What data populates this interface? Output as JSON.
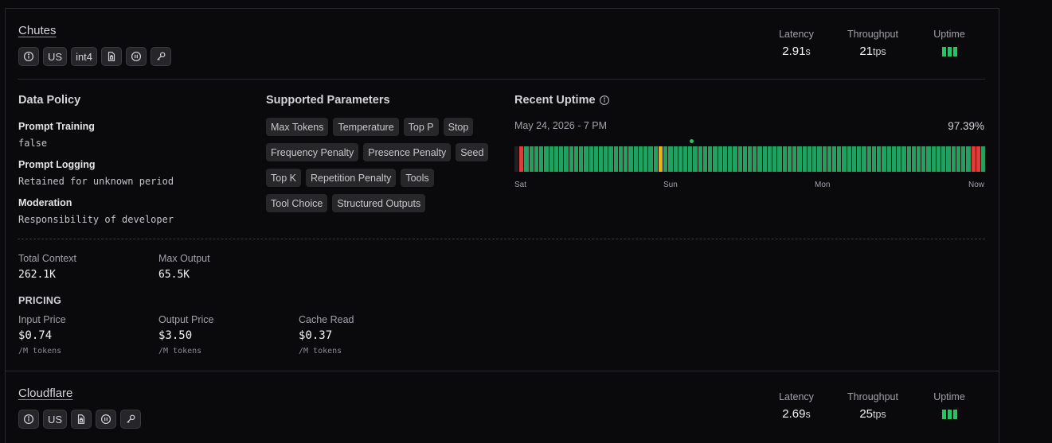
{
  "providers": [
    {
      "name": "Chutes",
      "tags": [
        {
          "icon": "info-icon"
        },
        {
          "label": "US"
        },
        {
          "label": "int4"
        },
        {
          "icon": "document-lock-icon"
        },
        {
          "icon": "pause-circle-icon"
        },
        {
          "icon": "key-icon"
        }
      ],
      "latency": {
        "label": "Latency",
        "value": "2.91",
        "unit": "s"
      },
      "throughput": {
        "label": "Throughput",
        "value": "21",
        "unit": "tps"
      },
      "uptime_label": "Uptime",
      "data_policy": {
        "title": "Data Policy",
        "items": [
          {
            "label": "Prompt Training",
            "value": "false"
          },
          {
            "label": "Prompt Logging",
            "value": "Retained for unknown period"
          },
          {
            "label": "Moderation",
            "value": "Responsibility of developer"
          }
        ]
      },
      "supported_parameters": {
        "title": "Supported Parameters",
        "items": [
          "Max Tokens",
          "Temperature",
          "Top P",
          "Stop",
          "Frequency Penalty",
          "Presence Penalty",
          "Seed",
          "Top K",
          "Repetition Penalty",
          "Tools",
          "Tool Choice",
          "Structured Outputs"
        ]
      },
      "recent_uptime": {
        "title": "Recent Uptime",
        "date": "May 24, 2026 - 7 PM",
        "percent": "97.39%",
        "axis_labels": [
          "Sat",
          "Sun",
          "Mon",
          "Now"
        ],
        "bar_status": [
          "none",
          "down",
          "ok",
          "ok",
          "ok",
          "ok",
          "ok",
          "ok",
          "ok",
          "ok",
          "ok",
          "ok",
          "ok",
          "ok",
          "ok",
          "ok",
          "ok",
          "ok",
          "ok",
          "ok",
          "ok",
          "ok",
          "ok",
          "ok",
          "ok",
          "ok",
          "ok",
          "ok",
          "ok",
          "degraded",
          "ok",
          "ok",
          "ok",
          "ok",
          "ok",
          "ok",
          "ok",
          "ok",
          "ok",
          "ok",
          "ok",
          "ok",
          "ok",
          "ok",
          "ok",
          "ok",
          "ok",
          "ok",
          "ok",
          "ok",
          "ok",
          "ok",
          "ok",
          "ok",
          "ok",
          "ok",
          "ok",
          "ok",
          "ok",
          "ok",
          "ok",
          "ok",
          "ok",
          "ok",
          "ok",
          "ok",
          "ok",
          "ok",
          "ok",
          "ok",
          "ok",
          "ok",
          "ok",
          "ok",
          "ok",
          "ok",
          "ok",
          "ok",
          "ok",
          "ok",
          "ok",
          "ok",
          "ok",
          "ok",
          "ok",
          "ok",
          "ok",
          "ok",
          "ok",
          "ok",
          "ok",
          "ok",
          "down",
          "down",
          "ok"
        ],
        "colors": {
          "ok": "#22a060",
          "down": "#dc3c3c",
          "degraded": "#eab308",
          "none": "#1f1f23"
        }
      },
      "context": {
        "total_label": "Total Context",
        "total_value": "262.1K",
        "max_label": "Max Output",
        "max_value": "65.5K"
      },
      "pricing": {
        "title": "PRICING",
        "items": [
          {
            "label": "Input Price",
            "value": "$0.74",
            "unit": "/M tokens"
          },
          {
            "label": "Output Price",
            "value": "$3.50",
            "unit": "/M tokens"
          },
          {
            "label": "Cache Read",
            "value": "$0.37",
            "unit": "/M tokens"
          }
        ]
      }
    },
    {
      "name": "Cloudflare",
      "tags": [
        {
          "icon": "info-icon"
        },
        {
          "label": "US"
        },
        {
          "icon": "document-lock-icon"
        },
        {
          "icon": "pause-circle-icon"
        },
        {
          "icon": "key-icon"
        }
      ],
      "latency": {
        "label": "Latency",
        "value": "2.69",
        "unit": "s"
      },
      "throughput": {
        "label": "Throughput",
        "value": "25",
        "unit": "tps"
      },
      "uptime_label": "Uptime"
    }
  ]
}
